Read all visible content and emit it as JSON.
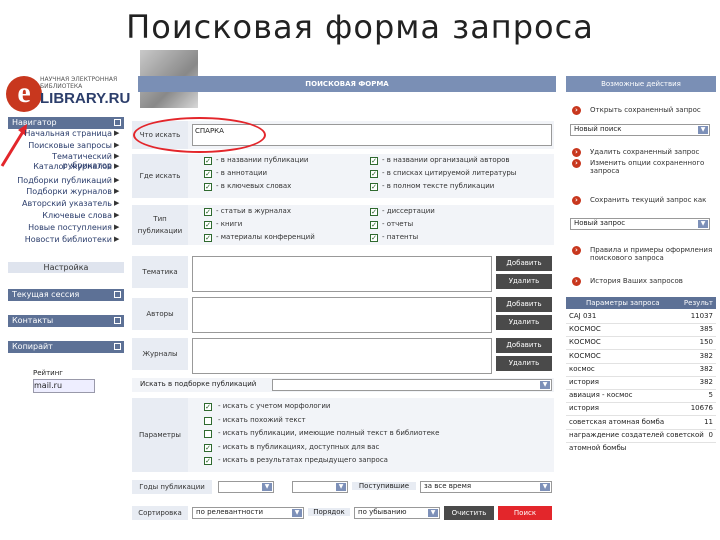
{
  "slide_title": "Поисковая  форма  запроса",
  "logo": {
    "letter": "e",
    "subtitle": "НАУЧНАЯ ЭЛЕКТРОННАЯ БИБЛИОТЕКА",
    "name": "LIBRARY.RU"
  },
  "left_nav": {
    "header": "Навигатор",
    "items": [
      "Начальная страница",
      "Поисковые запросы",
      "Тематический рубрикатор",
      "Каталог журналов",
      "Подборки публикаций",
      "Подборки журналов",
      "Авторский указатель",
      "Ключевые слова",
      "Новые поступления",
      "Новости библиотеки"
    ],
    "setup": "Настройка",
    "session": "Текущая сессия",
    "contacts": "Контакты",
    "copyright": "Копирайт",
    "rating": "Рейтинг",
    "counter": "mail.ru"
  },
  "form": {
    "header": "ПОИСКОВАЯ ФОРМА",
    "what_label": "Что искать",
    "what_value": "СПАРКА",
    "where_label": "Где искать",
    "where_options": [
      "- в названии публикации",
      "- в аннотации",
      "- в ключевых словах",
      "- в названии организаций авторов",
      "- в списках цитируемой литературы",
      "- в полном тексте публикации"
    ],
    "type_label": "Тип публикации",
    "type_options": [
      "- статьи в журналах",
      "- книги",
      "- материалы конференций",
      "- диссертации",
      "- отчеты",
      "- патенты"
    ],
    "topic_label": "Тематика",
    "author_label": "Авторы",
    "journals_label": "Журналы",
    "add_label": "Добавить",
    "remove_label": "Удалить",
    "subset_label": "Искать в подборке публикаций",
    "params_label": "Параметры",
    "params_options": [
      "- искать с учетом морфологии",
      "- искать похожий текст",
      "- искать публикации, имеющие полный текст в библиотеке",
      "- искать в публикациях, доступных для вас",
      "- искать в результатах предыдущего запроса"
    ],
    "years_label": "Годы публикации",
    "received_label": "Поступившие",
    "received_value": "за все время",
    "sort_label": "Сортировка",
    "sort_value": "по релевантности",
    "order_label": "Порядок",
    "order_value": "по убыванию",
    "clear_label": "Очистить",
    "search_label": "Поиск"
  },
  "right_panel": {
    "header": "Возможные действия",
    "actions": [
      "Открыть сохраненный запрос",
      "Удалить сохраненный запрос",
      "Изменить опции сохраненного запроса",
      "Сохранить текущий запрос как",
      "Правила и примеры оформления поискового запроса",
      "История Ваших запросов"
    ],
    "select1": "Новый поиск",
    "select2": "Новый запрос",
    "table_header": {
      "query": "Параметры запроса",
      "count": "Результ"
    },
    "history": [
      {
        "q": "CAJ 031",
        "n": "11037"
      },
      {
        "q": "КОСМОС",
        "n": "385"
      },
      {
        "q": "КОСМОС",
        "n": "150"
      },
      {
        "q": "КОСМОС",
        "n": "382"
      },
      {
        "q": "космос",
        "n": "382"
      },
      {
        "q": "история",
        "n": "382"
      },
      {
        "q": "авиация - космос",
        "n": "5"
      },
      {
        "q": "история",
        "n": "10676"
      },
      {
        "q": "советская атомная бомба",
        "n": "11"
      },
      {
        "q": "награждение создателей советской атомной бомбы",
        "n": "0"
      }
    ]
  },
  "colors": {
    "accent": "#7a8fb5",
    "nav_header": "#5d7196",
    "highlight": "#e3262b",
    "checkbox": "#2f6a2f"
  }
}
